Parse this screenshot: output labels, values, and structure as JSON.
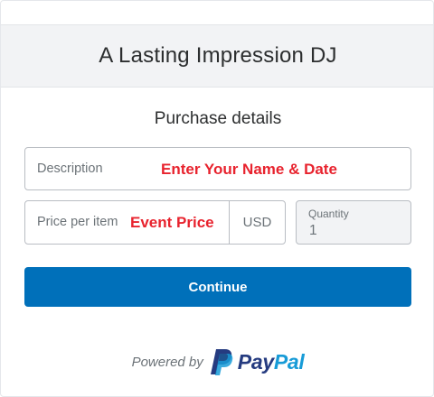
{
  "header": {
    "title": "A Lasting Impression DJ"
  },
  "purchase": {
    "title": "Purchase details",
    "description": {
      "label": "Description",
      "value": "Enter Your Name & Date"
    },
    "price": {
      "label": "Price per item",
      "value": "Event Price",
      "currency": "USD"
    },
    "quantity": {
      "label": "Quantity",
      "value": "1"
    }
  },
  "actions": {
    "continue_label": "Continue"
  },
  "footer": {
    "powered_by": "Powered by",
    "brand_pay": "Pay",
    "brand_pal": "Pal",
    "logo_icon": "paypal-p-icon"
  },
  "colors": {
    "accent": "#0070ba",
    "highlight_text": "#e8232e",
    "paypal_dark": "#253b80",
    "paypal_light": "#179bd7"
  }
}
